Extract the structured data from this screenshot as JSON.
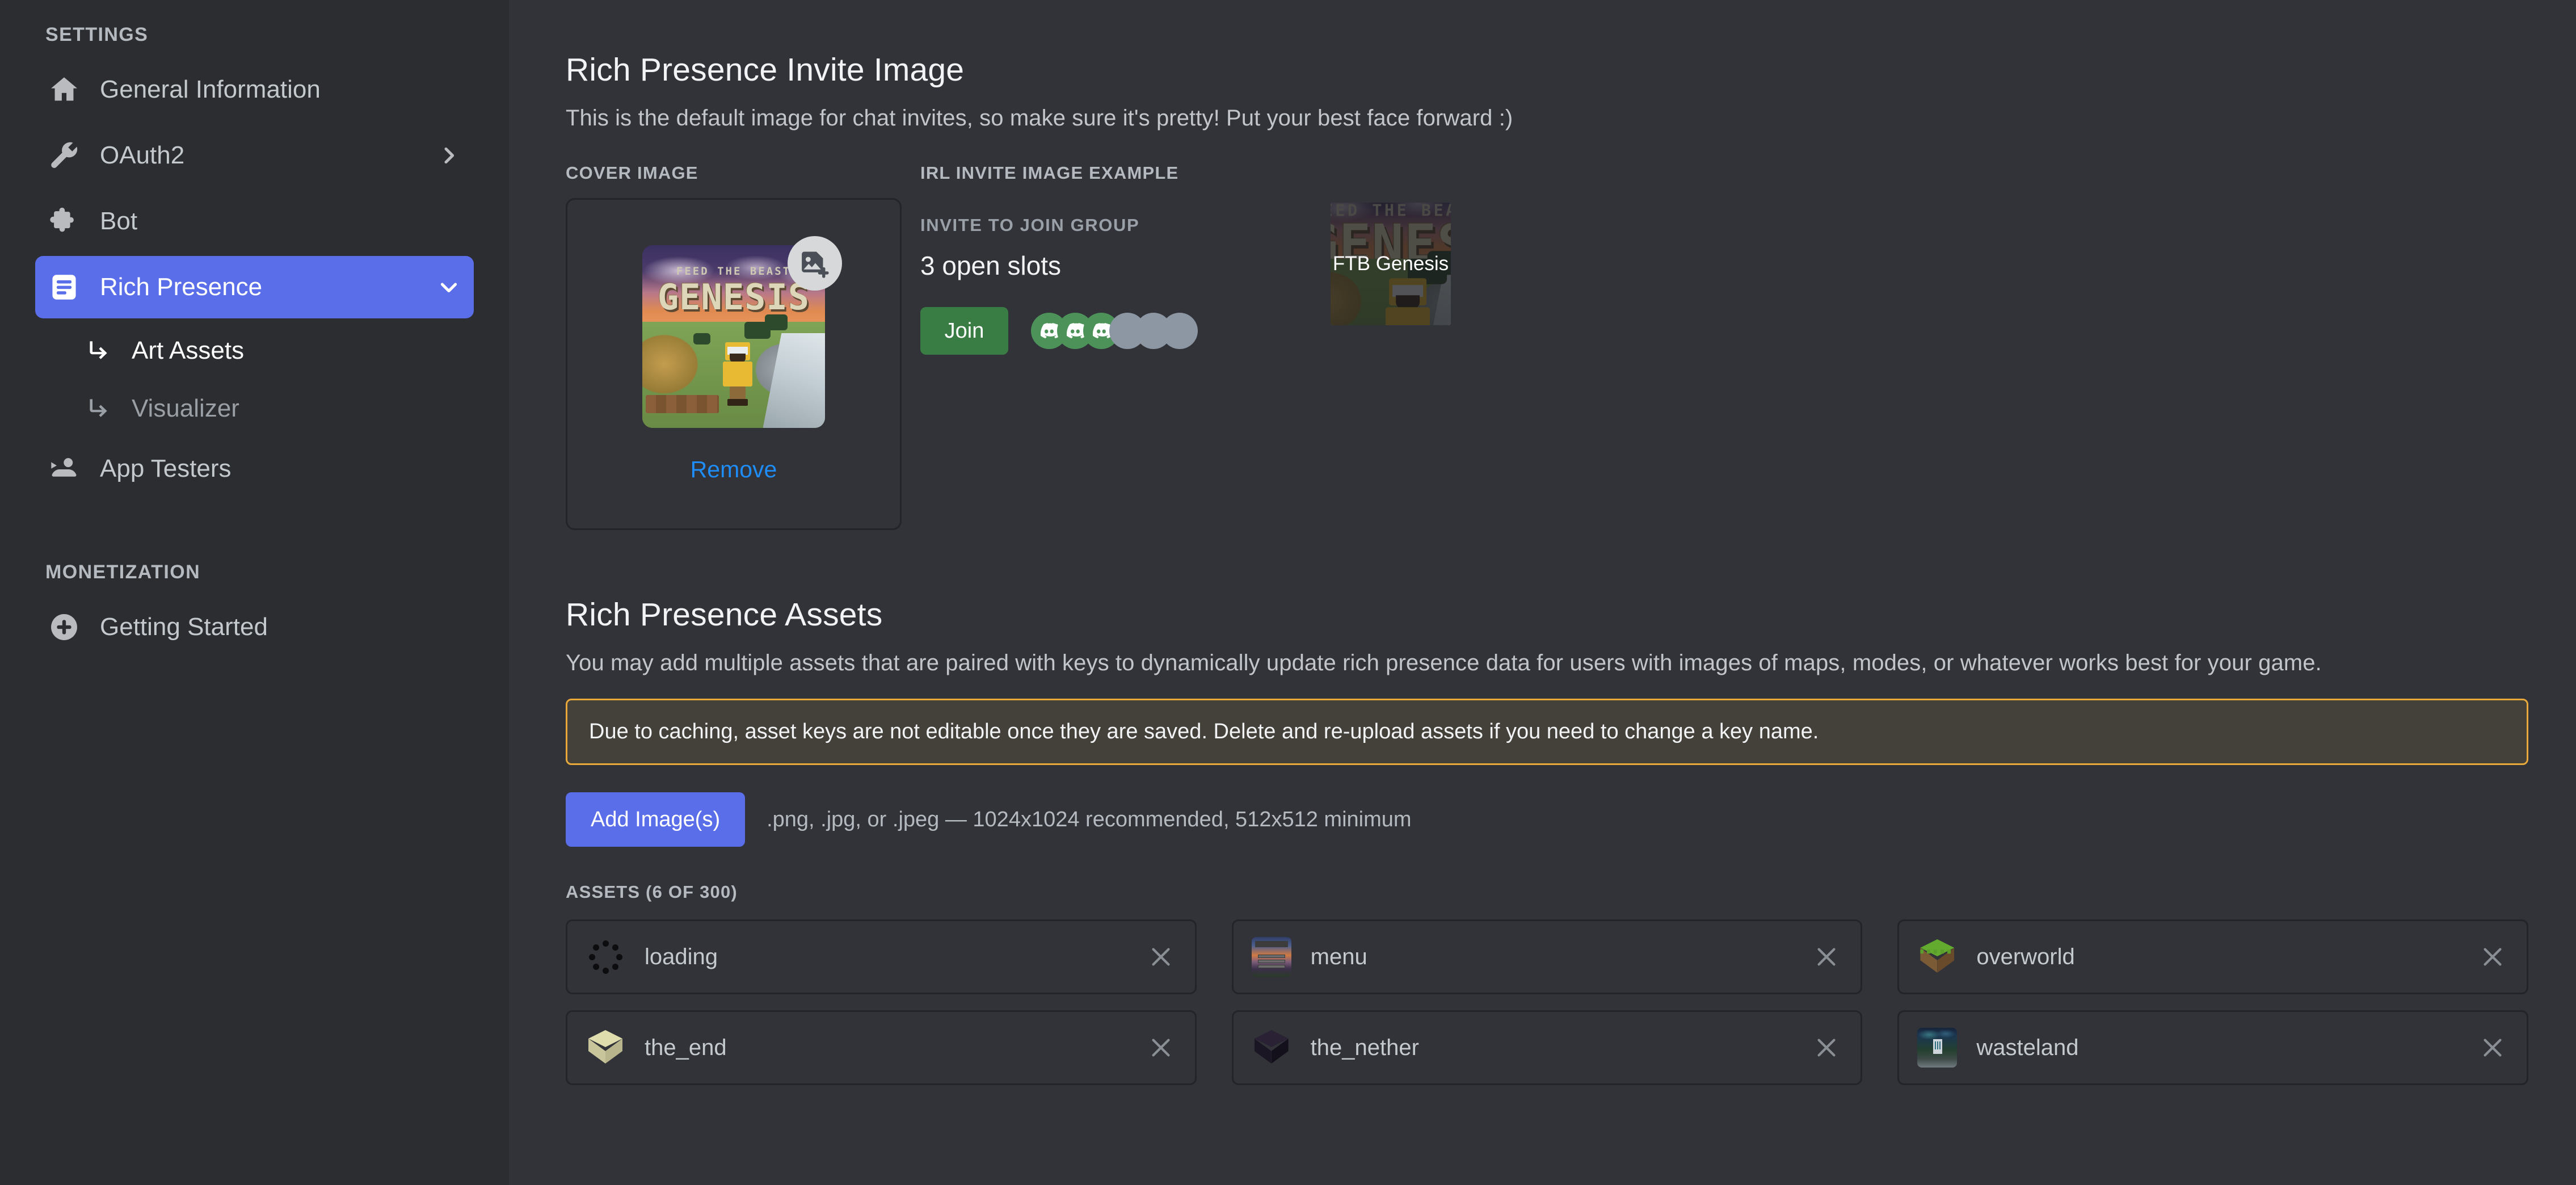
{
  "sidebar": {
    "sections": [
      {
        "title": "SETTINGS"
      },
      {
        "title": "MONETIZATION"
      }
    ],
    "settings_label": "SETTINGS",
    "monetization_label": "MONETIZATION",
    "items": [
      {
        "label": "General Information",
        "icon": "home-icon"
      },
      {
        "label": "OAuth2",
        "icon": "wrench-icon",
        "chevron": "chevron-right-icon"
      },
      {
        "label": "Bot",
        "icon": "puzzle-piece-icon"
      },
      {
        "label": "Rich Presence",
        "icon": "rich-presence-icon",
        "chevron": "chevron-down-icon",
        "active": true
      }
    ],
    "subitems": [
      {
        "label": "Art Assets",
        "selected": true
      },
      {
        "label": "Visualizer",
        "selected": false
      }
    ],
    "app_testers": {
      "label": "App Testers",
      "icon": "people-icon"
    },
    "monetization_items": [
      {
        "label": "Getting Started",
        "icon": "plus-circle-icon"
      }
    ]
  },
  "invite_section": {
    "title": "Rich Presence Invite Image",
    "description": "This is the default image for chat invites, so make sure it's pretty! Put your best face forward :)",
    "cover_label": "COVER IMAGE",
    "irl_label": "IRL INVITE IMAGE EXAMPLE",
    "remove_label": "Remove",
    "upload_icon": "add-image-icon",
    "cover_art_title_small": "FEED THE BEAST",
    "cover_art_title_big": "GENESIS"
  },
  "invite_preview": {
    "eyebrow": "INVITE TO JOIN GROUP",
    "slots_text": "3 open slots",
    "join_label": "Join",
    "avatars_filled": 3,
    "avatars_empty": 3,
    "game_tile_label": "FTB Genesis",
    "join_color": "#3a7d44",
    "avatar_filled_color": "#4d9359",
    "avatar_empty_color": "#8d97a4"
  },
  "assets_section": {
    "title": "Rich Presence Assets",
    "description": "You may add multiple assets that are paired with keys to dynamically update rich presence data for users with images of maps, modes, or whatever works best for your game.",
    "callout": "Due to caching, asset keys are not editable once they are saved. Delete and re-upload assets if you need to change a key name.",
    "callout_border_color": "#e8a93a",
    "callout_bg_color": "#44413a",
    "add_button_label": "Add Image(s)",
    "add_button_color": "#5b6eea",
    "upload_hint": ".png, .jpg, or .jpeg — 1024x1024 recommended, 512x512 minimum",
    "assets_count_label": "ASSETS (6 OF 300)",
    "assets": [
      {
        "name": "loading",
        "thumb": "spinner-thumb",
        "remove_icon": "close-icon"
      },
      {
        "name": "menu",
        "thumb": "minecraft-menu-thumb",
        "remove_icon": "close-icon"
      },
      {
        "name": "overworld",
        "thumb": "grass-block-thumb",
        "remove_icon": "close-icon"
      },
      {
        "name": "the_end",
        "thumb": "end-stone-thumb",
        "remove_icon": "close-icon"
      },
      {
        "name": "the_nether",
        "thumb": "obsidian-block-thumb",
        "remove_icon": "close-icon"
      },
      {
        "name": "wasteland",
        "thumb": "wasteland-thumb",
        "remove_icon": "close-icon"
      }
    ]
  },
  "theme": {
    "sidebar_bg": "#2b2d31",
    "main_bg": "#313338",
    "accent": "#5b6eea",
    "link": "#1f8df7",
    "border": "#232428"
  }
}
